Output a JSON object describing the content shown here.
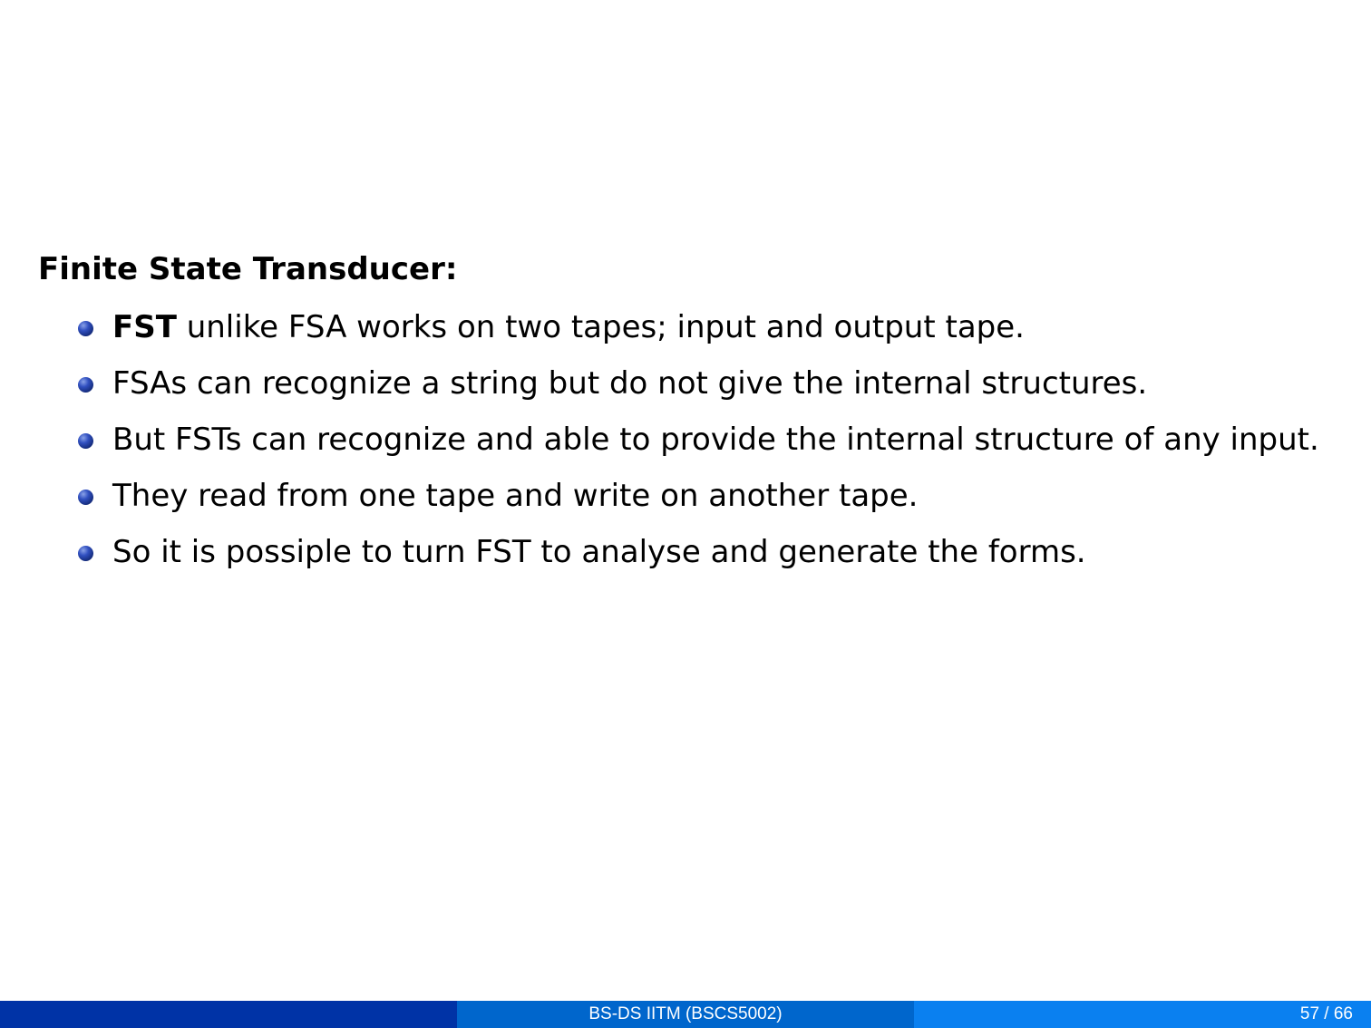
{
  "slide": {
    "heading": "Finite State Transducer:",
    "bullets": [
      {
        "bold": "FST",
        "text": " unlike FSA works on two tapes; input and output tape."
      },
      {
        "bold": "",
        "text": "FSAs can recognize a string but do not give the internal structures."
      },
      {
        "bold": "",
        "text": "But FSTs can recognize and able to provide the internal structure of any input."
      },
      {
        "bold": "",
        "text": "They read from one tape and write on another tape."
      },
      {
        "bold": "",
        "text": "So it is possiple to turn FST to analyse and generate the forms."
      }
    ]
  },
  "footer": {
    "title": "BS-DS IITM (BSCS5002)",
    "page": "57 / 66"
  },
  "colors": {
    "footer_left": "#0033a6",
    "footer_center": "#0066cc",
    "footer_right": "#0a80f0",
    "bullet": "#142b7a"
  }
}
